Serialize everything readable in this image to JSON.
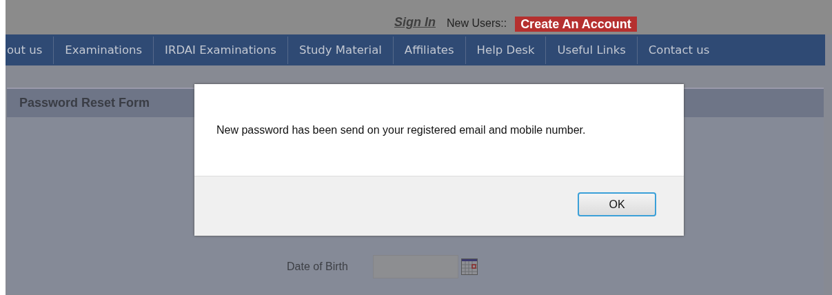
{
  "header": {
    "sign_in": "Sign In",
    "new_users_label": "New Users::",
    "create_account": "Create An Account"
  },
  "nav": {
    "items": [
      "out us",
      "Examinations",
      "IRDAI Examinations",
      "Study Material",
      "Affiliates",
      "Help Desk",
      "Useful Links",
      "Contact us"
    ]
  },
  "form": {
    "title": "Password Reset Form",
    "fields": [
      {
        "label": "Date of Birth",
        "kind": "date"
      }
    ]
  },
  "dialog": {
    "message": "New password has been send on your registered email and mobile number.",
    "buttons": [
      "OK"
    ]
  }
}
